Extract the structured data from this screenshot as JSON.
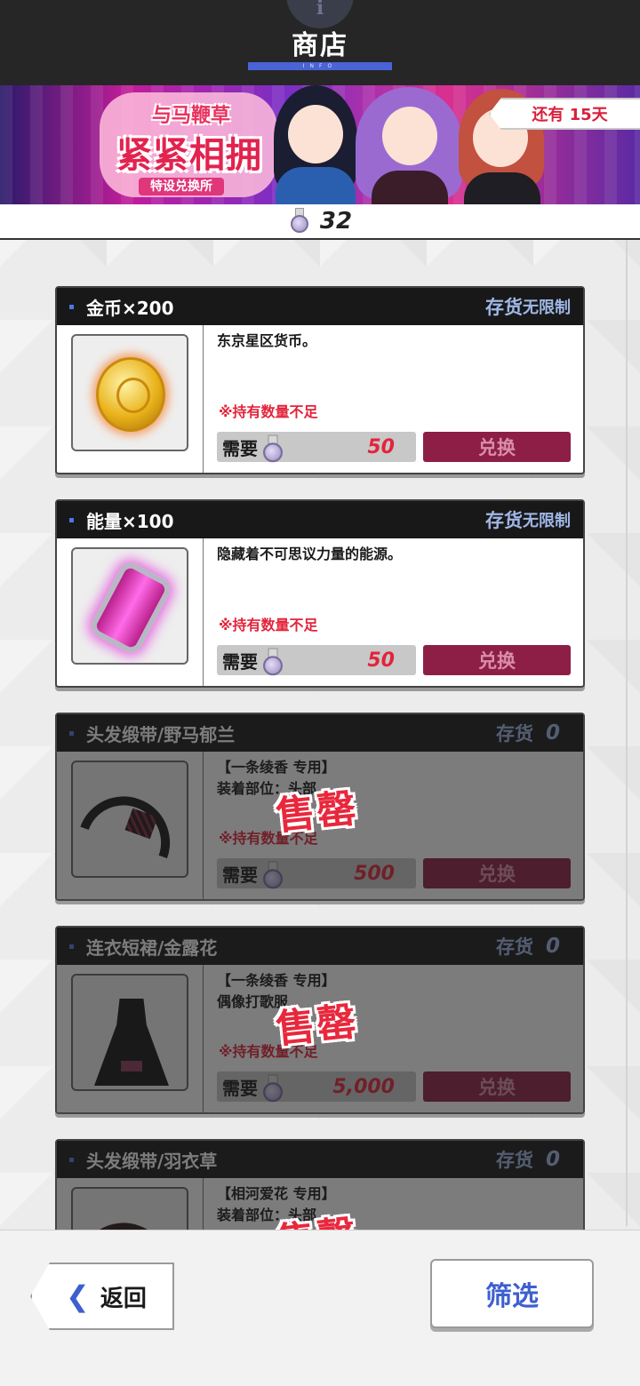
{
  "header": {
    "title": "商店",
    "title_sub": "INFO"
  },
  "banner": {
    "logo_line1": "与马鞭草",
    "logo_line2": "紧紧相拥",
    "logo_line3": "特设兑换所",
    "days_left": "还有 15天"
  },
  "currency": {
    "icon": "medal-icon",
    "count": "32"
  },
  "items": [
    {
      "name": "金币×200",
      "stock_label": "存货",
      "stock_value": "无限制",
      "description": "东京星区货币。",
      "warning": "※持有数量不足",
      "need_label": "需要",
      "price": "50",
      "exchange_label": "兑换",
      "sold_out": false
    },
    {
      "name": "能量×100",
      "stock_label": "存货",
      "stock_value": "无限制",
      "description": "隐藏着不可思议力量的能源。",
      "warning": "※持有数量不足",
      "need_label": "需要",
      "price": "50",
      "exchange_label": "兑换",
      "sold_out": false
    },
    {
      "name": "头发缎带/野马郁兰",
      "stock_label": "存货",
      "stock_value": "0",
      "description": "【一条绫香 专用】\n装着部位：头部",
      "warning": "※持有数量不足",
      "need_label": "需要",
      "price": "500",
      "exchange_label": "兑换",
      "sold_out": true,
      "sold_out_label": "售罄"
    },
    {
      "name": "连衣短裙/金露花",
      "stock_label": "存货",
      "stock_value": "0",
      "description": "【一条绫香 专用】\n偶像打歌服",
      "warning": "※持有数量不足",
      "need_label": "需要",
      "price": "5,000",
      "exchange_label": "兑换",
      "sold_out": true,
      "sold_out_label": "售罄"
    },
    {
      "name": "头发缎带/羽衣草",
      "stock_label": "存货",
      "stock_value": "0",
      "description": "【相河爱花 专用】\n装着部位：头部",
      "sold_out": true,
      "sold_out_label": "售罄"
    }
  ],
  "footer": {
    "back_label": "返回",
    "filter_label": "筛选"
  },
  "colors": {
    "accent_blue": "#3d5fcf",
    "price_red": "#e2243b",
    "exchange_btn": "#8d1f46",
    "stock_text": "#9fb7e6"
  }
}
